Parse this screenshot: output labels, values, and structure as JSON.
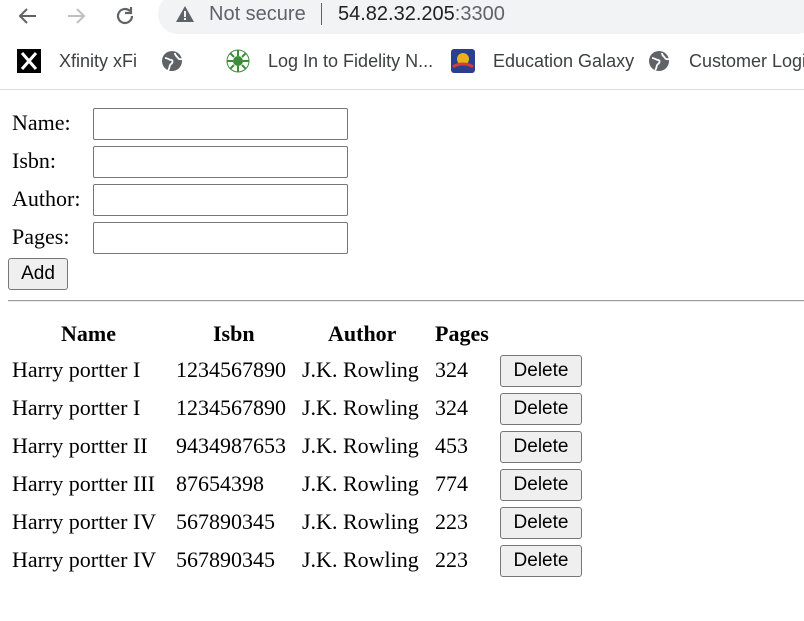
{
  "browser": {
    "security_text": "Not secure",
    "url_host": "54.82.32.205",
    "url_port": ":3300",
    "bookmarks": [
      {
        "label": "Xfinity xFi",
        "icon": "xfinity-icon"
      },
      {
        "label": "",
        "icon": "globe-icon"
      },
      {
        "label": "Log In to Fidelity N...",
        "icon": "fidelity-icon"
      },
      {
        "label": "Education Galaxy",
        "icon": "education-galaxy-icon"
      },
      {
        "label": "Customer Login",
        "icon": "globe-icon"
      }
    ]
  },
  "form": {
    "name_label": "Name:",
    "isbn_label": "Isbn:",
    "author_label": "Author:",
    "pages_label": "Pages:",
    "name_value": "",
    "isbn_value": "",
    "author_value": "",
    "pages_value": "",
    "add_label": "Add"
  },
  "table": {
    "headers": [
      "Name",
      "Isbn",
      "Author",
      "Pages"
    ],
    "delete_label": "Delete",
    "rows": [
      [
        "Harry portter I",
        "1234567890",
        "J.K. Rowling",
        "324"
      ],
      [
        "Harry portter I",
        "1234567890",
        "J.K. Rowling",
        "324"
      ],
      [
        "Harry portter II",
        "9434987653",
        "J.K. Rowling",
        "453"
      ],
      [
        "Harry portter III",
        "87654398",
        "J.K. Rowling",
        "774"
      ],
      [
        "Harry portter IV",
        "567890345",
        "J.K. Rowling",
        "223"
      ],
      [
        "Harry portter IV",
        "567890345",
        "J.K. Rowling",
        "223"
      ]
    ]
  }
}
